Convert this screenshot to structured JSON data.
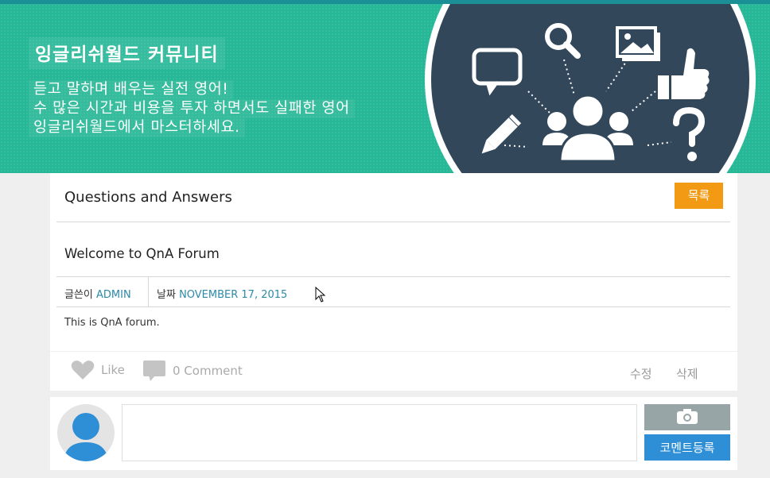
{
  "banner": {
    "title": "잉글리쉬월드 커뮤니티",
    "subtitle_lines": [
      "듣고 말하며 배우는 실전 영어!",
      "수 많은 시간과 비용을 투자 하면서도 실패한 영어",
      "잉글리쉬월드에서 마스터하세요."
    ]
  },
  "board": {
    "title": "Questions and Answers",
    "list_button": "목록"
  },
  "post": {
    "title": "Welcome to QnA Forum",
    "author_label": "글쓴이",
    "author": "ADMIN",
    "date_label": "날짜",
    "date": "NOVEMBER 17, 2015",
    "body": "This is QnA forum."
  },
  "actions": {
    "like_label": "Like",
    "comment_label": "0 Comment",
    "edit_label": "수정",
    "delete_label": "삭제"
  },
  "comment_form": {
    "submit_label": "코멘트등록"
  },
  "colors": {
    "banner_bg": "#25b796",
    "circle_bg": "#33475b",
    "list_button": "#f29a13",
    "submit_button": "#2e8fd6",
    "camera_button": "#98a5a6",
    "link": "#2c8aa8"
  }
}
